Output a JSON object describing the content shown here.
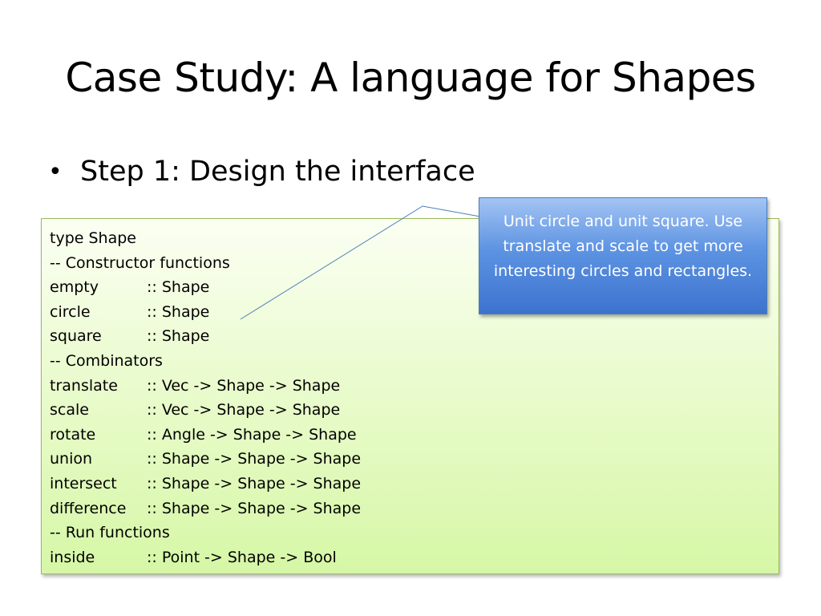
{
  "slide": {
    "title": "Case Study: A language for Shapes",
    "bullet": {
      "marker": "•",
      "text": "Step 1: Design the interface"
    },
    "code": [
      {
        "name": "type Shape",
        "type": ""
      },
      {
        "name": "-- Constructor functions",
        "type": ""
      },
      {
        "name": "empty",
        "type": ":: Shape"
      },
      {
        "name": "circle",
        "type": ":: Shape"
      },
      {
        "name": "square",
        "type": ":: Shape"
      },
      {
        "name": "-- Combinators",
        "type": ""
      },
      {
        "name": "translate",
        "type": ":: Vec -> Shape -> Shape"
      },
      {
        "name": "scale",
        "type": ":: Vec -> Shape -> Shape"
      },
      {
        "name": "rotate",
        "type": ":: Angle -> Shape -> Shape"
      },
      {
        "name": "union",
        "type": ":: Shape -> Shape -> Shape"
      },
      {
        "name": "intersect",
        "type": ":: Shape -> Shape -> Shape"
      },
      {
        "name": "difference",
        "type": ":: Shape -> Shape -> Shape"
      },
      {
        "name": "-- Run functions",
        "type": ""
      },
      {
        "name": "inside",
        "type": ":: Point -> Shape -> Bool"
      }
    ],
    "callout": {
      "text": "Unit circle and unit square. Use translate and scale to get more interesting circles and rectangles."
    }
  },
  "colors": {
    "code_box_border": "#9bbb59",
    "code_box_fill_top": "#fbfff3",
    "code_box_fill_bottom": "#d6f7a6",
    "callout_fill_top": "#a3c4f3",
    "callout_fill_bottom": "#3c73cf",
    "callout_border": "#4a7ebb",
    "callout_text": "#ffffff"
  }
}
